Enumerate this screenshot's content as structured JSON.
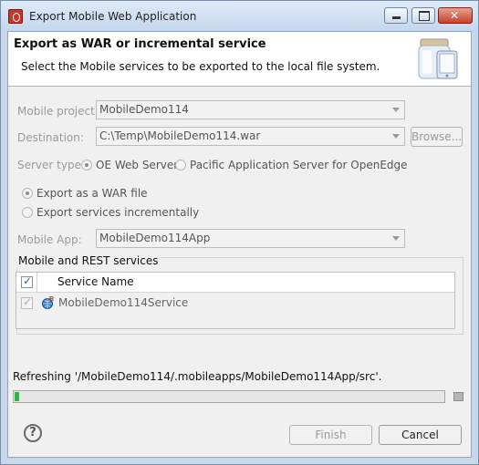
{
  "window": {
    "title": "Export Mobile Web Application"
  },
  "header": {
    "title": "Export as WAR or incremental service",
    "description": "Select the Mobile services to be exported to the local file system."
  },
  "form": {
    "mobile_project_label": "Mobile project:",
    "mobile_project_value": "MobileDemo114",
    "destination_label": "Destination:",
    "destination_value": "C:\\Temp\\MobileDemo114.war",
    "browse_label": "Browse...",
    "server_type_label": "Server type:",
    "server_oe_label": "OE Web Server",
    "server_pacific_label": "Pacific Application Server for OpenEdge",
    "export_war_label": "Export as a WAR file",
    "export_incremental_label": "Export services incrementally",
    "mobile_app_label": "Mobile App:",
    "mobile_app_value": "MobileDemo114App"
  },
  "services": {
    "group_title": "Mobile and REST services",
    "column_header": "Service Name",
    "rows": [
      {
        "name": "MobileDemo114Service",
        "checked": true
      }
    ]
  },
  "status": {
    "text": "Refreshing '/MobileDemo114/.mobileapps/MobileDemo114App/src'.",
    "progress_fraction": 0.01
  },
  "footer": {
    "help_glyph": "?",
    "finish_label": "Finish",
    "cancel_label": "Cancel"
  },
  "colors": {
    "progress": "#36b04a",
    "title_bar": "#c7d8ec"
  }
}
